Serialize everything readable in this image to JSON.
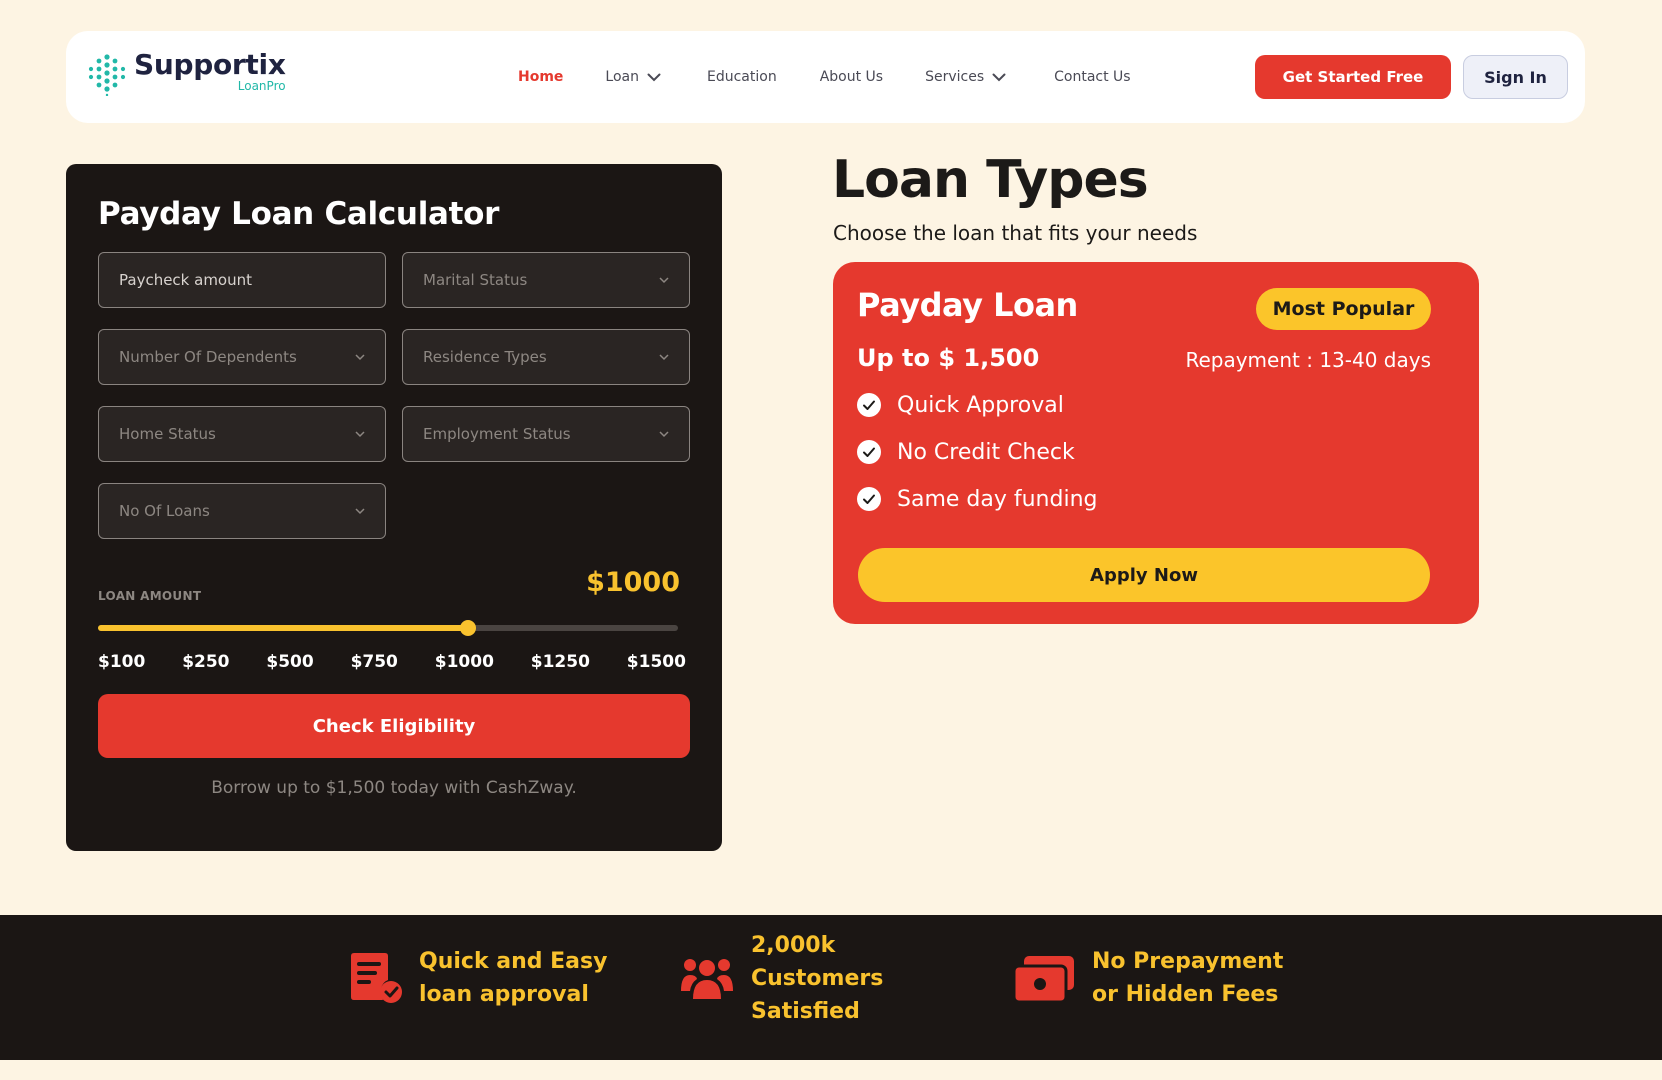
{
  "header": {
    "logo": {
      "name": "Supportix",
      "sub": "LoanPro"
    },
    "nav": [
      {
        "label": "Home",
        "active": true,
        "has_dropdown": false
      },
      {
        "label": "Loan",
        "active": false,
        "has_dropdown": true
      },
      {
        "label": "Education",
        "active": false,
        "has_dropdown": false
      },
      {
        "label": "About Us",
        "active": false,
        "has_dropdown": false
      },
      {
        "label": "Services",
        "active": false,
        "has_dropdown": true
      },
      {
        "label": "Contact Us",
        "active": false,
        "has_dropdown": false
      }
    ],
    "get_started_label": "Get Started Free",
    "sign_in_label": "Sign In"
  },
  "calculator": {
    "title": "Payday Loan Calculator",
    "fields": [
      {
        "label": "Paycheck amount",
        "type": "input"
      },
      {
        "label": "Marital Status",
        "type": "select"
      },
      {
        "label": "Number Of Dependents",
        "type": "select"
      },
      {
        "label": "Residence Types",
        "type": "select"
      },
      {
        "label": "Home Status",
        "type": "select"
      },
      {
        "label": "Employment Status",
        "type": "select"
      },
      {
        "label": "No Of Loans",
        "type": "select"
      }
    ],
    "amount_label": "LOAN AMOUNT",
    "amount_value": "$1000",
    "slider": {
      "min": 100,
      "max": 1500,
      "value": 1000
    },
    "ticks": [
      "$100",
      "$250",
      "$500",
      "$750",
      "$1000",
      "$1250",
      "$1500"
    ],
    "check_label": "Check Eligibility",
    "note": "Borrow up to $1,500 today with CashZway."
  },
  "loan_types": {
    "title": "Loan Types",
    "subtitle": "Choose the loan that fits your needs",
    "card": {
      "title": "Payday Loan",
      "badge": "Most Popular",
      "amount": "Up to $ 1,500",
      "repayment": "Repayment : 13-40 days",
      "features": [
        "Quick Approval",
        "No Credit Check",
        "Same day funding"
      ],
      "apply_label": "Apply Now"
    }
  },
  "highlights": [
    {
      "icon": "document-check-icon",
      "lines": [
        "Quick and Easy",
        "loan approval"
      ]
    },
    {
      "icon": "customers-icon",
      "lines": [
        "2,000k",
        "Customers",
        "Satisfied"
      ]
    },
    {
      "icon": "cash-icon",
      "lines": [
        "No Prepayment",
        "or Hidden Fees"
      ]
    }
  ],
  "colors": {
    "background": "#fdf4e3",
    "accent_red": "#e5392e",
    "accent_yellow": "#f9c22e",
    "dark": "#1b1614",
    "logo_teal": "#22b8a8"
  }
}
